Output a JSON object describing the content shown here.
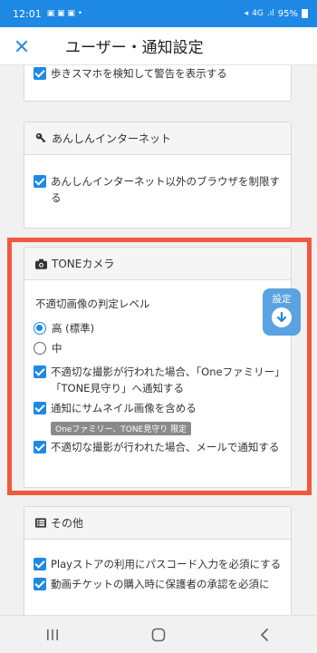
{
  "status_bar": {
    "time": "12:01",
    "indicators": "N",
    "wifi": "4G",
    "battery": "95%"
  },
  "header": {
    "title": "ユーザー・通知設定"
  },
  "cards": {
    "top_partial": {
      "item": "歩きスマホを検知して警告を表示する"
    },
    "anshin": {
      "title": "あんしんインターネット",
      "icon": "key-icon",
      "item": "あんしんインターネット以外のブラウザを制限する"
    },
    "tone_camera": {
      "title": "TONEカメラ",
      "icon": "camera-icon",
      "level_label": "不適切画像の判定レベル",
      "radio_high": "高 (標準)",
      "radio_mid": "中",
      "item1": "不適切な撮影が行われた場合、「Oneファミリー」「TONE見守り」へ通知する",
      "item2": "通知にサムネイル画像を含める",
      "badge": "Oneファミリー、TONE見守り 限定",
      "item3": "不適切な撮影が行われた場合、メールで通知する"
    },
    "other": {
      "title": "その他",
      "icon": "list-icon",
      "item1": "Playストアの利用にパスコード入力を必須にする",
      "item2": "動画チケットの購入時に保護者の承認を必須に"
    }
  },
  "fab": {
    "label": "設定"
  },
  "colors": {
    "accent": "#1e88e5",
    "highlight": "#f0593e"
  }
}
